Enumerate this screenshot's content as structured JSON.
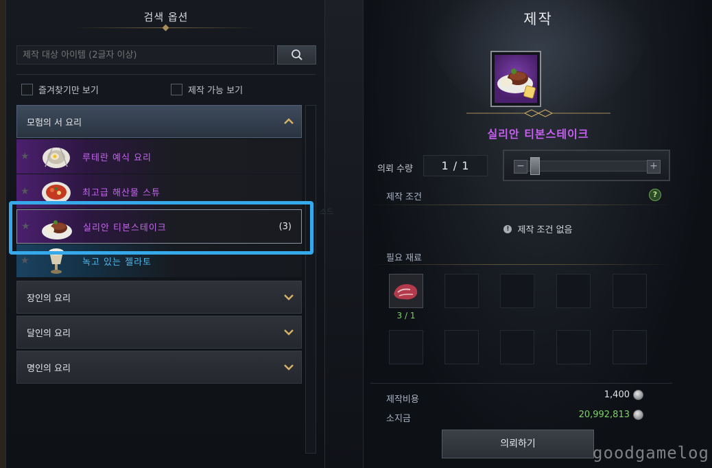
{
  "left": {
    "title": "검색 옵션",
    "search_placeholder": "제작 대상 아이템 (2글자 이상)",
    "filter_favorites": "즐겨찾기만 보기",
    "filter_craftable": "제작 가능 보기",
    "categories": [
      {
        "label": "모험의 서 요리",
        "state": "expanded"
      },
      {
        "label": "장인의 요리",
        "state": "collapsed"
      },
      {
        "label": "달인의 요리",
        "state": "collapsed"
      },
      {
        "label": "명인의 요리",
        "state": "collapsed"
      }
    ],
    "recipes": [
      {
        "name": "루테란 예식 요리",
        "grade_color": "#c566f0"
      },
      {
        "name": "최고급 해산물 스튜",
        "grade_color": "#c566f0"
      },
      {
        "name": "실리안 티본스테이크",
        "count": "(3)",
        "grade_color": "#c566f0"
      },
      {
        "name": "녹고 있는 젤라토",
        "grade_color": "#52b8ea"
      }
    ],
    "faint_text": "소드"
  },
  "right": {
    "title": "제작",
    "item_name": "실리안 티본스테이크",
    "qty_label": "의뢰 수량",
    "qty_value": "1 / 1",
    "slider_minus": "−",
    "slider_plus": "+",
    "cond_label": "제작 조건",
    "help": "?",
    "cond_none": "제작 조건 없음",
    "info_icon": "!",
    "materials_label": "필요 재료",
    "material_count": "3 / 1",
    "cost_label": "제작비용",
    "cost_value": "1,400",
    "gold_label": "소지금",
    "gold_value": "20,992,813",
    "request_button": "의뢰하기"
  },
  "watermark": "goodgamelog",
  "colors": {
    "accent_purple": "#c85ef2",
    "highlight_blue": "#36a9ea",
    "gold": "#d6b267",
    "money_green": "#7fd26a"
  }
}
